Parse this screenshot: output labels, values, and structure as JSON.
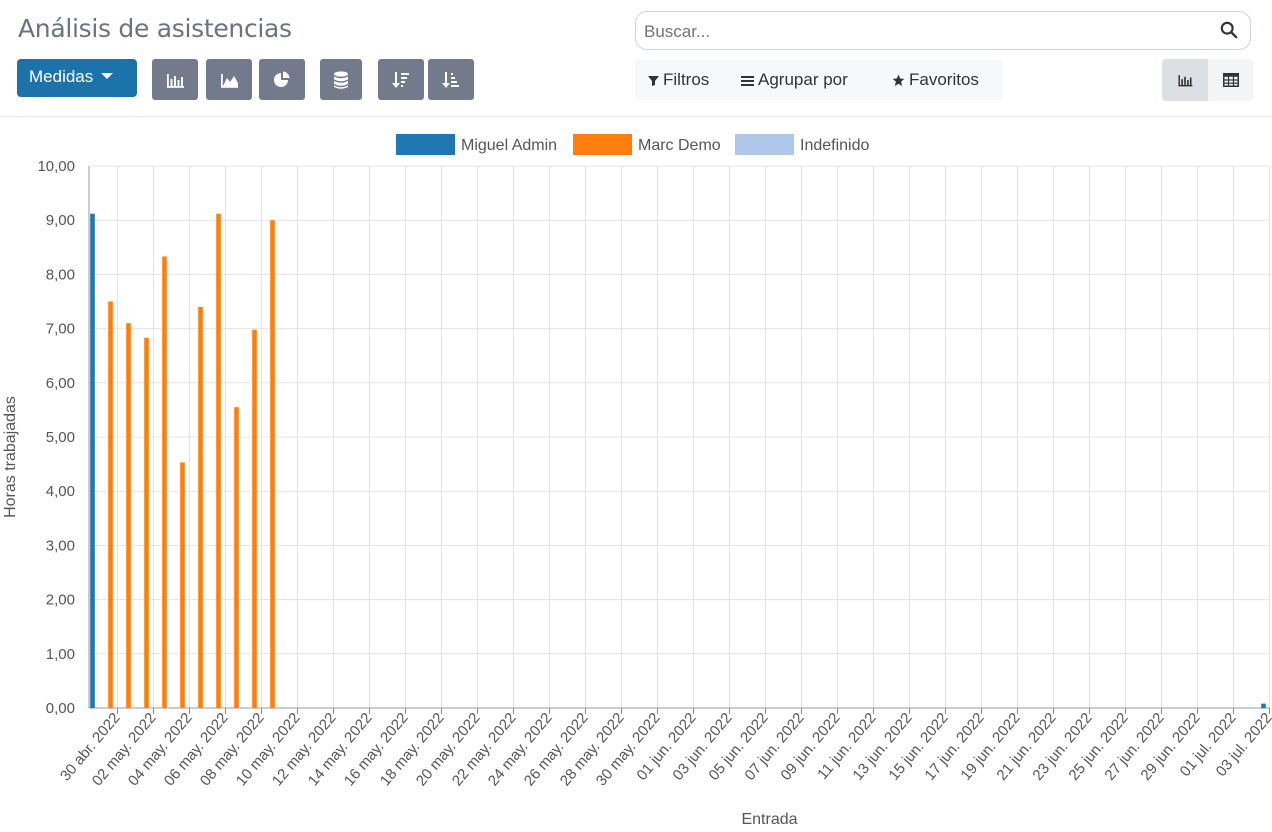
{
  "header": {
    "title": "Análisis de asistencias"
  },
  "search": {
    "placeholder": "Buscar..."
  },
  "toolbar": {
    "measures_label": "Medidas",
    "graph_buttons": [
      "bar-chart-icon",
      "line-chart-icon",
      "pie-chart-icon"
    ],
    "stack_button": "stack-icon",
    "sort_buttons": [
      "sort-descending-icon",
      "sort-ascending-icon"
    ]
  },
  "filters": {
    "filters_label": "Filtros",
    "group_by_label": "Agrupar por",
    "favorites_label": "Favoritos"
  },
  "view_switcher": {
    "active": "graph",
    "views": [
      "graph",
      "pivot"
    ]
  },
  "colors": {
    "primary": "#1b73a9",
    "miguel": "#1f77b4",
    "marc": "#ff7f0e",
    "indefinido": "#aec7e8"
  },
  "chart_data": {
    "type": "bar",
    "xlabel": "Entrada",
    "ylabel": "Horas trabajadas",
    "ylim": [
      0,
      10
    ],
    "y_ticks": [
      "0,00",
      "1,00",
      "2,00",
      "3,00",
      "4,00",
      "5,00",
      "6,00",
      "7,00",
      "8,00",
      "9,00",
      "10,00"
    ],
    "legend": [
      "Miguel Admin",
      "Marc Demo",
      "Indefinido"
    ],
    "legend_position": "top-center",
    "grid": true,
    "categories": [
      "30 abr. 2022",
      "01 may. 2022",
      "02 may. 2022",
      "03 may. 2022",
      "04 may. 2022",
      "05 may. 2022",
      "06 may. 2022",
      "07 may. 2022",
      "08 may. 2022",
      "09 may. 2022",
      "10 may. 2022",
      "11 may. 2022",
      "12 may. 2022",
      "13 may. 2022",
      "14 may. 2022",
      "15 may. 2022",
      "16 may. 2022",
      "17 may. 2022",
      "18 may. 2022",
      "19 may. 2022",
      "20 may. 2022",
      "21 may. 2022",
      "22 may. 2022",
      "23 may. 2022",
      "24 may. 2022",
      "25 may. 2022",
      "26 may. 2022",
      "27 may. 2022",
      "28 may. 2022",
      "29 may. 2022",
      "30 may. 2022",
      "31 may. 2022",
      "01 jun. 2022",
      "02 jun. 2022",
      "03 jun. 2022",
      "04 jun. 2022",
      "05 jun. 2022",
      "06 jun. 2022",
      "07 jun. 2022",
      "08 jun. 2022",
      "09 jun. 2022",
      "10 jun. 2022",
      "11 jun. 2022",
      "12 jun. 2022",
      "13 jun. 2022",
      "14 jun. 2022",
      "15 jun. 2022",
      "16 jun. 2022",
      "17 jun. 2022",
      "18 jun. 2022",
      "19 jun. 2022",
      "20 jun. 2022",
      "21 jun. 2022",
      "22 jun. 2022",
      "23 jun. 2022",
      "24 jun. 2022",
      "25 jun. 2022",
      "26 jun. 2022",
      "27 jun. 2022",
      "28 jun. 2022",
      "29 jun. 2022",
      "30 jun. 2022",
      "01 jul. 2022",
      "02 jul. 2022",
      "03 jul. 2022",
      "04 jul. 2022"
    ],
    "tick_labels": [
      "30 abr. 2022",
      "02 may. 2022",
      "04 may. 2022",
      "06 may. 2022",
      "08 may. 2022",
      "10 may. 2022",
      "12 may. 2022",
      "14 may. 2022",
      "16 may. 2022",
      "18 may. 2022",
      "20 may. 2022",
      "22 may. 2022",
      "24 may. 2022",
      "26 may. 2022",
      "28 may. 2022",
      "30 may. 2022",
      "01 jun. 2022",
      "03 jun. 2022",
      "05 jun. 2022",
      "07 jun. 2022",
      "09 jun. 2022",
      "11 jun. 2022",
      "13 jun. 2022",
      "15 jun. 2022",
      "17 jun. 2022",
      "19 jun. 2022",
      "21 jun. 2022",
      "23 jun. 2022",
      "25 jun. 2022",
      "27 jun. 2022",
      "29 jun. 2022",
      "01 jul. 2022",
      "03 jul. 2022"
    ],
    "series": [
      {
        "name": "Miguel Admin",
        "color": "#1f77b4",
        "points": [
          {
            "x": "30 abr. 2022",
            "y": 9.12
          },
          {
            "x": "04 jul. 2022",
            "y": 0.08
          }
        ]
      },
      {
        "name": "Marc Demo",
        "color": "#ff7f0e",
        "points": [
          {
            "x": "01 may. 2022",
            "y": 7.5
          },
          {
            "x": "02 may. 2022",
            "y": 7.1
          },
          {
            "x": "03 may. 2022",
            "y": 6.83
          },
          {
            "x": "04 may. 2022",
            "y": 8.33
          },
          {
            "x": "05 may. 2022",
            "y": 4.53
          },
          {
            "x": "06 may. 2022",
            "y": 7.4
          },
          {
            "x": "07 may. 2022",
            "y": 9.12
          },
          {
            "x": "08 may. 2022",
            "y": 5.55
          },
          {
            "x": "09 may. 2022",
            "y": 6.98
          },
          {
            "x": "10 may. 2022",
            "y": 9.0
          }
        ]
      },
      {
        "name": "Indefinido",
        "color": "#aec7e8",
        "points": []
      }
    ]
  }
}
